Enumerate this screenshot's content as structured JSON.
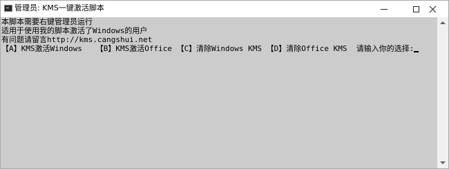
{
  "window": {
    "title": "管理员:  KMS一键激活脚本",
    "icon": "console-icon",
    "controls": {
      "minimize": "minimize-icon",
      "maximize": "maximize-icon",
      "close": "close-icon"
    }
  },
  "console": {
    "background": "#cccccc",
    "foreground": "#000000",
    "lines": [
      "本脚本需要右键管理员运行",
      "适用于使用我的脚本激活了Windows的用户",
      "有问题请留言http://kms.cangshui.net",
      "【A】KMS激活Windows   【B】KMS激活Office 【C】清除Windows KMS 【D】清除Office KMS  请输入你的选择:"
    ]
  }
}
